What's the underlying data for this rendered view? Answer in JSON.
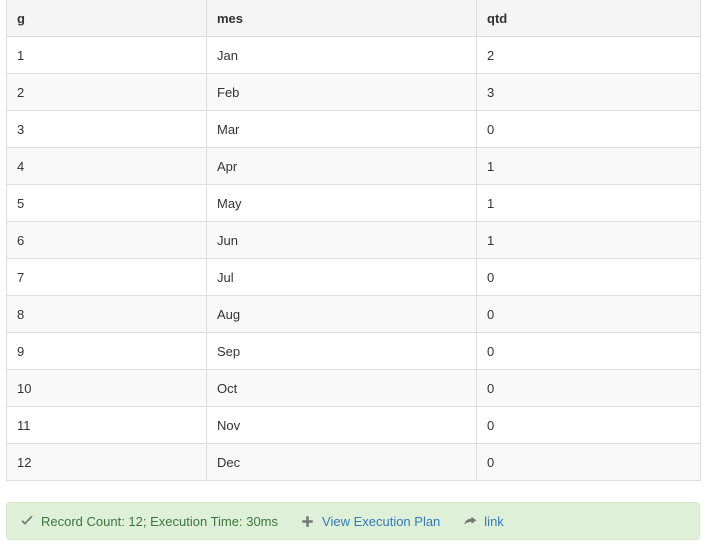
{
  "table": {
    "columns": [
      {
        "key": "g",
        "label": "g"
      },
      {
        "key": "mes",
        "label": "mes"
      },
      {
        "key": "qtd",
        "label": "qtd"
      }
    ],
    "rows": [
      {
        "g": "1",
        "mes": "Jan",
        "qtd": "2"
      },
      {
        "g": "2",
        "mes": "Feb",
        "qtd": "3"
      },
      {
        "g": "3",
        "mes": "Mar",
        "qtd": "0"
      },
      {
        "g": "4",
        "mes": "Apr",
        "qtd": "1"
      },
      {
        "g": "5",
        "mes": "May",
        "qtd": "1"
      },
      {
        "g": "6",
        "mes": "Jun",
        "qtd": "1"
      },
      {
        "g": "7",
        "mes": "Jul",
        "qtd": "0"
      },
      {
        "g": "8",
        "mes": "Aug",
        "qtd": "0"
      },
      {
        "g": "9",
        "mes": "Sep",
        "qtd": "0"
      },
      {
        "g": "10",
        "mes": "Oct",
        "qtd": "0"
      },
      {
        "g": "11",
        "mes": "Nov",
        "qtd": "0"
      },
      {
        "g": "12",
        "mes": "Dec",
        "qtd": "0"
      }
    ]
  },
  "status_bar": {
    "record_count_icon": "check-icon",
    "record_count_text": "Record Count: 12; Execution Time: 30ms",
    "execution_plan_icon": "plus-icon",
    "execution_plan_label": "View Execution Plan",
    "link_icon": "share-arrow-icon",
    "link_label": "link",
    "colors": {
      "background": "#dff0d8",
      "border": "#d6e9c6",
      "text": "#3c763d",
      "link": "#337ab7",
      "icon": "#777777"
    }
  },
  "theme": {
    "header_background": "#f5f5f5",
    "row_stripe": "#f9f9f9",
    "border": "#dddddd",
    "text": "#333333"
  }
}
